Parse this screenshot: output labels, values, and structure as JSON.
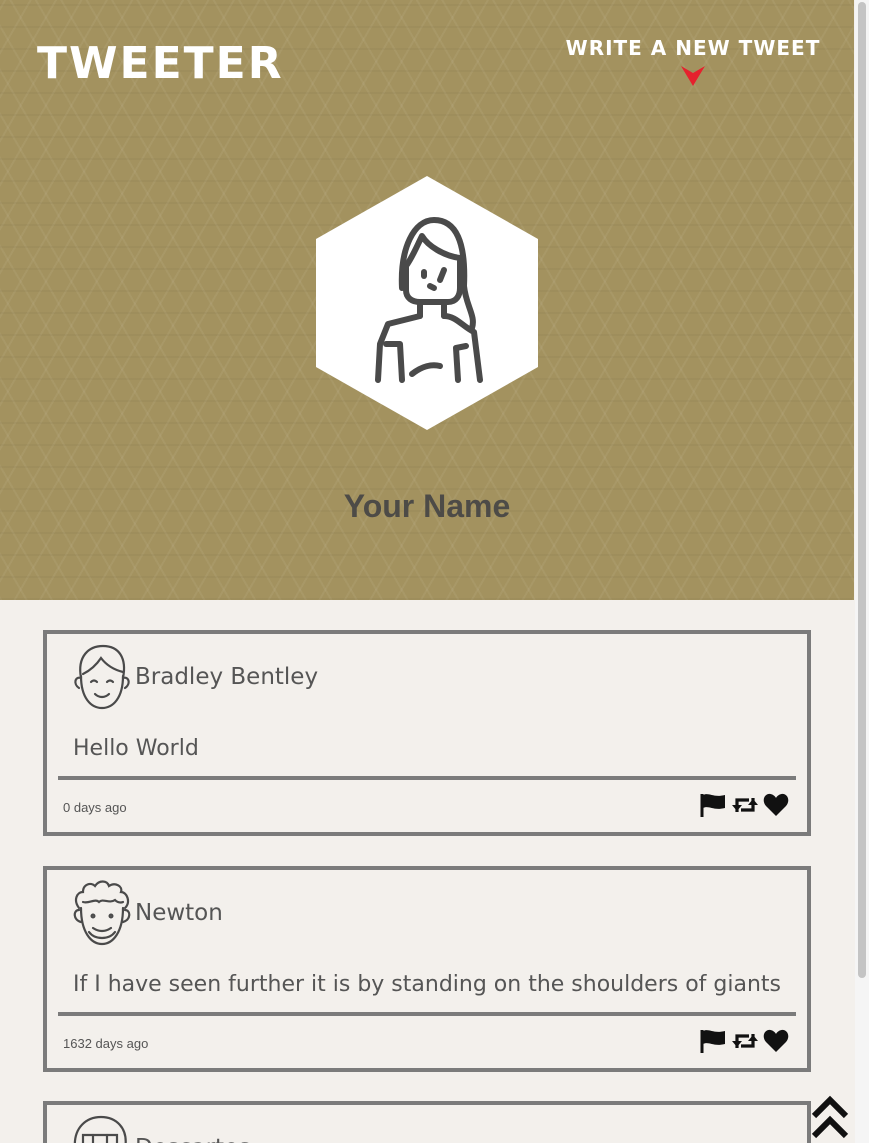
{
  "header": {
    "brand": "TWEETER",
    "compose_label": "WRITE A NEW TWEET",
    "compose_icon": "arrow-down-icon",
    "accent_color": "#e5212d",
    "background_color": "#a3925f"
  },
  "profile": {
    "name": "Your Name",
    "avatar_icon": "woman-avatar-icon"
  },
  "tweets": [
    {
      "user": "Bradley Bentley",
      "avatar_icon": "man-smiling-avatar-icon",
      "text": "Hello World",
      "time": "0 days ago",
      "actions": [
        "flag-icon",
        "retweet-icon",
        "heart-icon"
      ]
    },
    {
      "user": "Newton",
      "avatar_icon": "curly-hair-avatar-icon",
      "text": "If I have seen further it is by standing on the shoulders of giants",
      "time": "1632 days ago",
      "actions": [
        "flag-icon",
        "retweet-icon",
        "heart-icon"
      ]
    },
    {
      "user": "Descartes",
      "avatar_icon": "man-avatar-icon",
      "text": "",
      "time": "",
      "actions": []
    }
  ],
  "back_to_top_icon": "double-chevron-up-icon"
}
